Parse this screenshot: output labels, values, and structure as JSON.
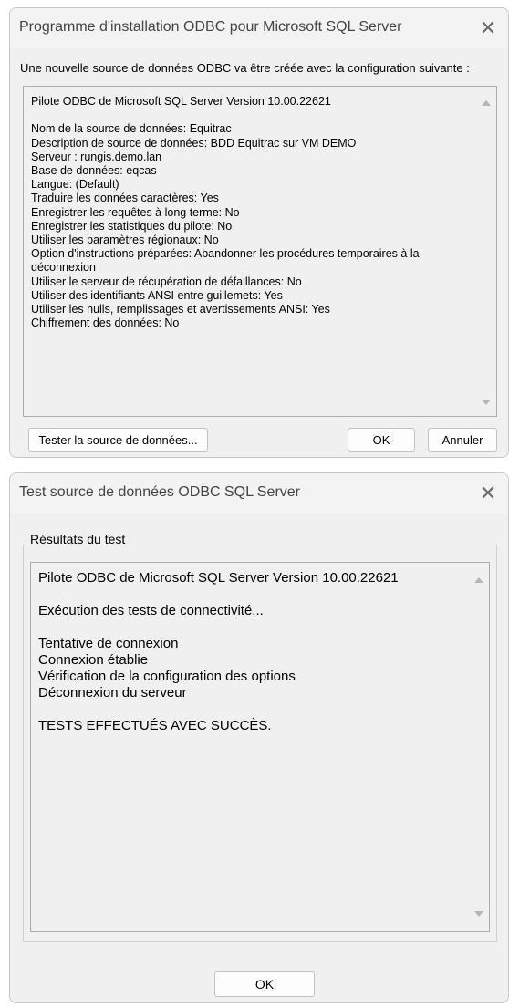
{
  "setup_dialog": {
    "title": "Programme d'installation ODBC pour Microsoft SQL Server",
    "intro": "Une nouvelle source de données ODBC va être créée avec la configuration suivante :",
    "summary_lines": [
      "Pilote ODBC de Microsoft SQL Server Version 10.00.22621",
      "",
      "Nom de la source de données: Equitrac",
      "Description de source de données: BDD Equitrac sur VM DEMO",
      "Serveur : rungis.demo.lan",
      "Base de données: eqcas",
      "Langue: (Default)",
      "Traduire les données caractères: Yes",
      "Enregistrer les requêtes à long terme: No",
      "Enregistrer les statistiques du pilote: No",
      "Utiliser les paramètres régionaux: No",
      "Option d'instructions préparées: Abandonner les procédures temporaires à la",
      "déconnexion",
      "Utiliser le serveur de récupération de défaillances: No",
      "Utiliser des identifiants ANSI entre guillemets: Yes",
      "Utiliser les nulls, remplissages et avertissements ANSI: Yes",
      "Chiffrement des données: No"
    ],
    "test_button": "Tester la source de données...",
    "ok_button": "OK",
    "cancel_button": "Annuler",
    "close_glyph": "✕"
  },
  "test_dialog": {
    "title": "Test source de données ODBC SQL Server",
    "group_label": "Résultats du test",
    "result_lines": [
      "Pilote ODBC de Microsoft SQL Server Version 10.00.22621",
      "",
      "Exécution des tests de connectivité...",
      "",
      "Tentative de connexion",
      "Connexion établie",
      "Vérification de la configuration des options",
      "Déconnexion du serveur",
      "",
      "TESTS EFFECTUÉS AVEC SUCCÈS."
    ],
    "ok_button": "OK",
    "close_glyph": "✕"
  }
}
